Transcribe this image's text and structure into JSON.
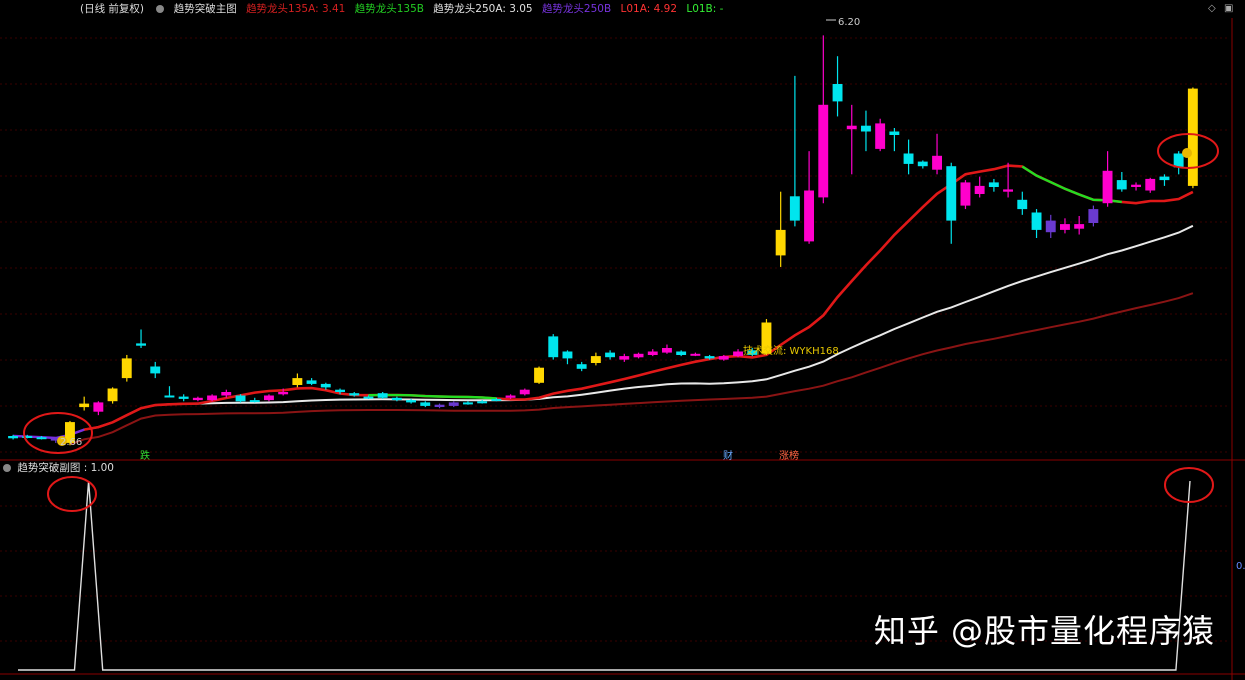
{
  "header": {
    "period": "(日线 前复权)",
    "main_title": "趋势突破主图",
    "indicators": [
      {
        "label": "趋势龙头135A: 3.41",
        "color": "#d42020"
      },
      {
        "label": "趋势龙头135B",
        "color": "#22cc22"
      },
      {
        "label": "趋势龙头250A: 3.05",
        "color": "#e0e0e0"
      },
      {
        "label": "趋势龙头250B",
        "color": "#7733dd"
      },
      {
        "label": "L01A: 4.92",
        "color": "#ff3333"
      },
      {
        "label": "L01B: -",
        "color": "#33ee33"
      }
    ]
  },
  "sub_header": {
    "title": "趋势突破副图",
    "value": ": 1.00"
  },
  "annotations": {
    "high_label": "6.20",
    "low_label": "2.66",
    "tech_label": "技术交流: WYKH168",
    "marker_die": "跌",
    "marker_cai": "财",
    "marker_zhangting": "涨榜",
    "sub_right_value": "0."
  },
  "watermark": "知乎 @股市量化程序猿",
  "colors": {
    "up_body": "#00e5ee",
    "down_body": "#ff00cc",
    "up_big": "#ffd700",
    "down_dark": "#6a3ad0",
    "ma_red": "#e01818",
    "ma_dark_red": "#8a1414",
    "ma_white": "#e8e8e8",
    "ma_green": "#22dd22",
    "ma_purple": "#7a2ee0"
  },
  "chart_data": {
    "type": "candlestick",
    "main": {
      "candles": [
        {
          "o": 2.72,
          "c": 2.74,
          "h": 2.75,
          "l": 2.71,
          "color": "up"
        },
        {
          "o": 2.74,
          "c": 2.73,
          "h": 2.75,
          "l": 2.72,
          "color": "up"
        },
        {
          "o": 2.73,
          "c": 2.72,
          "h": 2.74,
          "l": 2.71,
          "color": "up"
        },
        {
          "o": 2.72,
          "c": 2.7,
          "h": 2.73,
          "l": 2.68,
          "color": "dark"
        },
        {
          "o": 2.68,
          "c": 2.86,
          "h": 2.87,
          "l": 2.66,
          "color": "gold"
        },
        {
          "o": 2.99,
          "c": 3.02,
          "h": 3.08,
          "l": 2.96,
          "color": "gold"
        },
        {
          "o": 3.03,
          "c": 2.95,
          "h": 3.04,
          "l": 2.92,
          "color": "down"
        },
        {
          "o": 3.04,
          "c": 3.15,
          "h": 3.16,
          "l": 3.02,
          "color": "gold"
        },
        {
          "o": 3.24,
          "c": 3.41,
          "h": 3.44,
          "l": 3.21,
          "color": "gold"
        },
        {
          "o": 3.54,
          "c": 3.52,
          "h": 3.66,
          "l": 3.5,
          "color": "up"
        },
        {
          "o": 3.34,
          "c": 3.28,
          "h": 3.38,
          "l": 3.24,
          "color": "up"
        },
        {
          "o": 3.09,
          "c": 3.09,
          "h": 3.17,
          "l": 3.08,
          "color": "up"
        },
        {
          "o": 3.08,
          "c": 3.06,
          "h": 3.1,
          "l": 3.04,
          "color": "up"
        },
        {
          "o": 3.07,
          "c": 3.05,
          "h": 3.08,
          "l": 3.04,
          "color": "down"
        },
        {
          "o": 3.09,
          "c": 3.05,
          "h": 3.1,
          "l": 3.04,
          "color": "down"
        },
        {
          "o": 3.12,
          "c": 3.09,
          "h": 3.14,
          "l": 3.07,
          "color": "down"
        },
        {
          "o": 3.09,
          "c": 3.04,
          "h": 3.1,
          "l": 3.03,
          "color": "up"
        },
        {
          "o": 3.05,
          "c": 3.04,
          "h": 3.07,
          "l": 3.03,
          "color": "up"
        },
        {
          "o": 3.09,
          "c": 3.05,
          "h": 3.1,
          "l": 3.04,
          "color": "down"
        },
        {
          "o": 3.12,
          "c": 3.1,
          "h": 3.15,
          "l": 3.09,
          "color": "down"
        },
        {
          "o": 3.24,
          "c": 3.18,
          "h": 3.28,
          "l": 3.16,
          "color": "gold"
        },
        {
          "o": 3.22,
          "c": 3.19,
          "h": 3.24,
          "l": 3.18,
          "color": "up"
        },
        {
          "o": 3.19,
          "c": 3.16,
          "h": 3.2,
          "l": 3.14,
          "color": "up"
        },
        {
          "o": 3.14,
          "c": 3.12,
          "h": 3.15,
          "l": 3.1,
          "color": "up"
        },
        {
          "o": 3.11,
          "c": 3.09,
          "h": 3.12,
          "l": 3.08,
          "color": "up"
        },
        {
          "o": 3.08,
          "c": 3.07,
          "h": 3.09,
          "l": 3.06,
          "color": "up"
        },
        {
          "o": 3.11,
          "c": 3.07,
          "h": 3.12,
          "l": 3.06,
          "color": "up"
        },
        {
          "o": 3.07,
          "c": 3.05,
          "h": 3.08,
          "l": 3.04,
          "color": "up"
        },
        {
          "o": 3.05,
          "c": 3.03,
          "h": 3.06,
          "l": 3.02,
          "color": "up"
        },
        {
          "o": 3.03,
          "c": 3.0,
          "h": 3.04,
          "l": 2.99,
          "color": "up"
        },
        {
          "o": 3.01,
          "c": 2.99,
          "h": 3.02,
          "l": 2.98,
          "color": "dark"
        },
        {
          "o": 3.03,
          "c": 3.0,
          "h": 3.04,
          "l": 2.99,
          "color": "dark"
        },
        {
          "o": 3.03,
          "c": 3.02,
          "h": 3.04,
          "l": 3.01,
          "color": "up"
        },
        {
          "o": 3.03,
          "c": 3.04,
          "h": 3.05,
          "l": 3.02,
          "color": "up"
        },
        {
          "o": 3.05,
          "c": 3.06,
          "h": 3.07,
          "l": 3.04,
          "color": "up"
        },
        {
          "o": 3.07,
          "c": 3.09,
          "h": 3.1,
          "l": 3.06,
          "color": "down"
        },
        {
          "o": 3.1,
          "c": 3.14,
          "h": 3.15,
          "l": 3.09,
          "color": "down"
        },
        {
          "o": 3.2,
          "c": 3.33,
          "h": 3.34,
          "l": 3.19,
          "color": "gold"
        },
        {
          "o": 3.42,
          "c": 3.6,
          "h": 3.62,
          "l": 3.4,
          "color": "up"
        },
        {
          "o": 3.47,
          "c": 3.41,
          "h": 3.48,
          "l": 3.36,
          "color": "up"
        },
        {
          "o": 3.36,
          "c": 3.32,
          "h": 3.38,
          "l": 3.3,
          "color": "up"
        },
        {
          "o": 3.37,
          "c": 3.43,
          "h": 3.46,
          "l": 3.35,
          "color": "gold"
        },
        {
          "o": 3.46,
          "c": 3.42,
          "h": 3.48,
          "l": 3.4,
          "color": "up"
        },
        {
          "o": 3.43,
          "c": 3.4,
          "h": 3.45,
          "l": 3.38,
          "color": "down"
        },
        {
          "o": 3.45,
          "c": 3.42,
          "h": 3.46,
          "l": 3.41,
          "color": "down"
        },
        {
          "o": 3.47,
          "c": 3.44,
          "h": 3.49,
          "l": 3.43,
          "color": "down"
        },
        {
          "o": 3.5,
          "c": 3.46,
          "h": 3.53,
          "l": 3.45,
          "color": "down"
        },
        {
          "o": 3.47,
          "c": 3.44,
          "h": 3.48,
          "l": 3.43,
          "color": "up"
        },
        {
          "o": 3.45,
          "c": 3.44,
          "h": 3.46,
          "l": 3.43,
          "color": "down"
        },
        {
          "o": 3.43,
          "c": 3.41,
          "h": 3.44,
          "l": 3.4,
          "color": "up"
        },
        {
          "o": 3.43,
          "c": 3.4,
          "h": 3.44,
          "l": 3.39,
          "color": "down"
        },
        {
          "o": 3.47,
          "c": 3.43,
          "h": 3.49,
          "l": 3.42,
          "color": "down"
        },
        {
          "o": 3.48,
          "c": 3.44,
          "h": 3.5,
          "l": 3.43,
          "color": "up"
        },
        {
          "o": 3.45,
          "c": 3.72,
          "h": 3.75,
          "l": 3.44,
          "color": "gold"
        },
        {
          "o": 4.3,
          "c": 4.52,
          "h": 4.85,
          "l": 4.2,
          "color": "gold"
        },
        {
          "o": 4.81,
          "c": 4.6,
          "h": 5.85,
          "l": 4.55,
          "color": "up"
        },
        {
          "o": 4.86,
          "c": 4.42,
          "h": 5.2,
          "l": 4.4,
          "color": "down"
        },
        {
          "o": 5.6,
          "c": 4.8,
          "h": 6.2,
          "l": 4.75,
          "color": "down"
        },
        {
          "o": 5.78,
          "c": 5.63,
          "h": 6.02,
          "l": 5.5,
          "color": "up"
        },
        {
          "o": 5.42,
          "c": 5.39,
          "h": 5.6,
          "l": 5.0,
          "color": "down"
        },
        {
          "o": 5.42,
          "c": 5.37,
          "h": 5.55,
          "l": 5.2,
          "color": "up"
        },
        {
          "o": 5.44,
          "c": 5.22,
          "h": 5.48,
          "l": 5.2,
          "color": "down"
        },
        {
          "o": 5.37,
          "c": 5.34,
          "h": 5.4,
          "l": 5.2,
          "color": "up"
        },
        {
          "o": 5.18,
          "c": 5.09,
          "h": 5.3,
          "l": 5.0,
          "color": "up"
        },
        {
          "o": 5.11,
          "c": 5.07,
          "h": 5.12,
          "l": 5.05,
          "color": "up"
        },
        {
          "o": 5.16,
          "c": 5.04,
          "h": 5.35,
          "l": 5.0,
          "color": "down"
        },
        {
          "o": 5.07,
          "c": 4.6,
          "h": 5.1,
          "l": 4.4,
          "color": "up"
        },
        {
          "o": 4.73,
          "c": 4.93,
          "h": 4.95,
          "l": 4.7,
          "color": "down"
        },
        {
          "o": 4.9,
          "c": 4.83,
          "h": 4.98,
          "l": 4.8,
          "color": "down"
        },
        {
          "o": 4.93,
          "c": 4.89,
          "h": 4.96,
          "l": 4.85,
          "color": "up"
        },
        {
          "o": 4.87,
          "c": 4.85,
          "h": 5.1,
          "l": 4.8,
          "color": "down"
        },
        {
          "o": 4.78,
          "c": 4.7,
          "h": 4.85,
          "l": 4.65,
          "color": "up"
        },
        {
          "o": 4.67,
          "c": 4.52,
          "h": 4.7,
          "l": 4.45,
          "color": "up"
        },
        {
          "o": 4.5,
          "c": 4.6,
          "h": 4.65,
          "l": 4.45,
          "color": "dark"
        },
        {
          "o": 4.52,
          "c": 4.57,
          "h": 4.62,
          "l": 4.49,
          "color": "down"
        },
        {
          "o": 4.57,
          "c": 4.53,
          "h": 4.64,
          "l": 4.48,
          "color": "down"
        },
        {
          "o": 4.58,
          "c": 4.7,
          "h": 4.73,
          "l": 4.55,
          "color": "dark"
        },
        {
          "o": 4.75,
          "c": 5.03,
          "h": 5.2,
          "l": 4.72,
          "color": "down"
        },
        {
          "o": 4.95,
          "c": 4.87,
          "h": 5.02,
          "l": 4.85,
          "color": "up"
        },
        {
          "o": 4.91,
          "c": 4.89,
          "h": 4.93,
          "l": 4.86,
          "color": "down"
        },
        {
          "o": 4.96,
          "c": 4.86,
          "h": 4.97,
          "l": 4.84,
          "color": "down"
        },
        {
          "o": 4.98,
          "c": 4.95,
          "h": 5.0,
          "l": 4.9,
          "color": "up"
        },
        {
          "o": 5.18,
          "c": 5.06,
          "h": 5.2,
          "l": 5.0,
          "color": "up"
        },
        {
          "o": 4.9,
          "c": 5.74,
          "h": 5.75,
          "l": 4.88,
          "color": "gold"
        }
      ],
      "ylim": [
        2.55,
        6.35
      ],
      "high_point": 6.2,
      "low_point": 2.66
    },
    "sub": {
      "values": [
        0,
        0,
        0,
        0,
        0,
        1,
        0,
        0,
        0,
        0,
        0,
        0,
        0,
        0,
        0,
        0,
        0,
        0,
        0,
        0,
        0,
        0,
        0,
        0,
        0,
        0,
        0,
        0,
        0,
        0,
        0,
        0,
        0,
        0,
        0,
        0,
        0,
        0,
        0,
        0,
        0,
        0,
        0,
        0,
        0,
        0,
        0,
        0,
        0,
        0,
        0,
        0,
        0,
        0,
        0,
        0,
        0,
        0,
        0,
        0,
        0,
        0,
        0,
        0,
        0,
        0,
        0,
        0,
        0,
        0,
        0,
        0,
        0,
        0,
        0,
        0,
        0,
        0,
        0,
        0,
        0,
        0,
        0,
        1
      ],
      "ylim": [
        0,
        1
      ]
    }
  }
}
